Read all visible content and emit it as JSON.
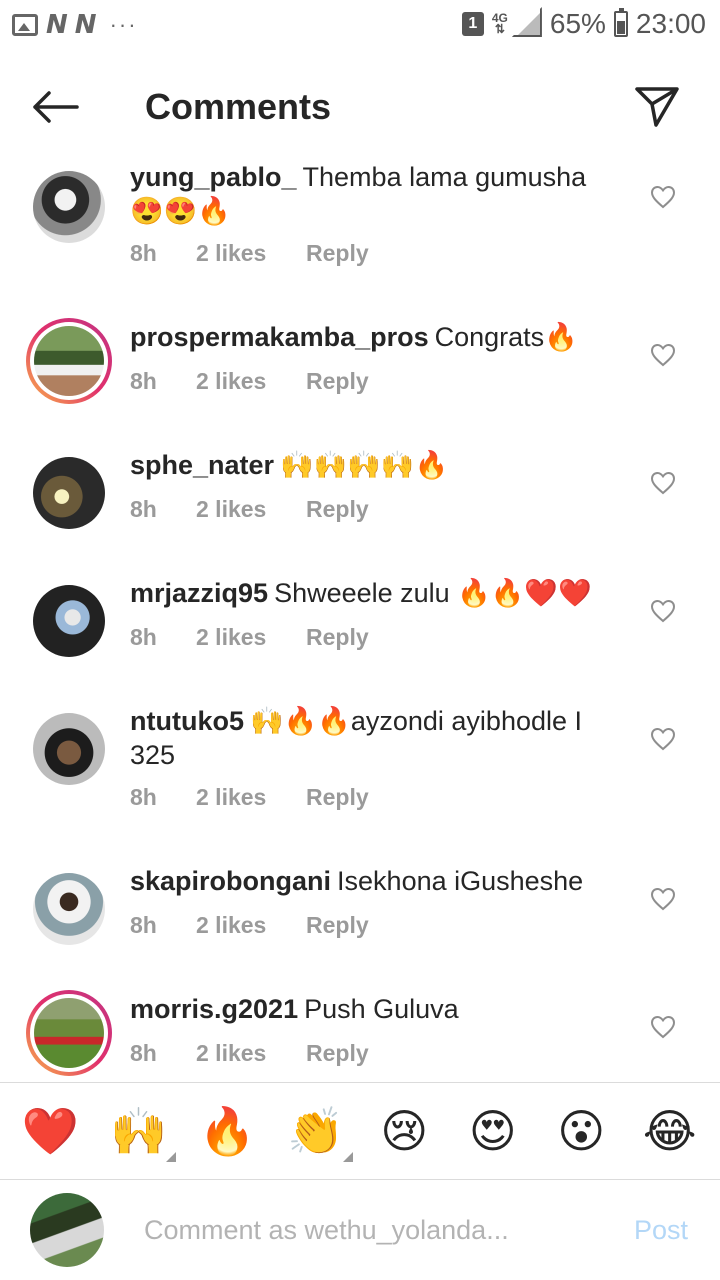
{
  "status_bar": {
    "n_icons": "N N",
    "dots": "···",
    "sim": "1",
    "network": "4G",
    "battery": "65%",
    "time": "23:00"
  },
  "header": {
    "title": "Comments"
  },
  "comments": [
    {
      "username": "yung_pablo_",
      "text": "Themba lama gumusha😍😍🔥",
      "time": "8h",
      "likes": "2 likes",
      "reply": "Reply"
    },
    {
      "username": "prospermakamba_pros",
      "text": "Congrats🔥",
      "time": "8h",
      "likes": "2 likes",
      "reply": "Reply"
    },
    {
      "username": "sphe_nater",
      "text": "🙌🙌🙌🙌🔥",
      "time": "8h",
      "likes": "2 likes",
      "reply": "Reply"
    },
    {
      "username": "mrjazziq95",
      "text": "Shweeele zulu 🔥🔥❤️❤️",
      "time": "8h",
      "likes": "2 likes",
      "reply": "Reply"
    },
    {
      "username": "ntutuko5",
      "text": "🙌🔥🔥ayzondi ayibhodle I 325",
      "time": "8h",
      "likes": "2 likes",
      "reply": "Reply"
    },
    {
      "username": "skapirobongani",
      "text": "Isekhona iGusheshe",
      "time": "8h",
      "likes": "2 likes",
      "reply": "Reply"
    },
    {
      "username": "morris.g2021",
      "text": "Push Guluva",
      "time": "8h",
      "likes": "2 likes",
      "reply": "Reply"
    }
  ],
  "emoji_bar": [
    "❤️",
    "🙌",
    "🔥",
    "👏",
    "😢",
    "😍",
    "😮",
    "😂"
  ],
  "composer": {
    "placeholder": "Comment as wethu_yolanda...",
    "post_label": "Post"
  },
  "colors": {
    "text": "#262626",
    "meta": "#9a9a9a",
    "post_disabled": "#b3d7f7",
    "divider": "#dbdbdb"
  }
}
